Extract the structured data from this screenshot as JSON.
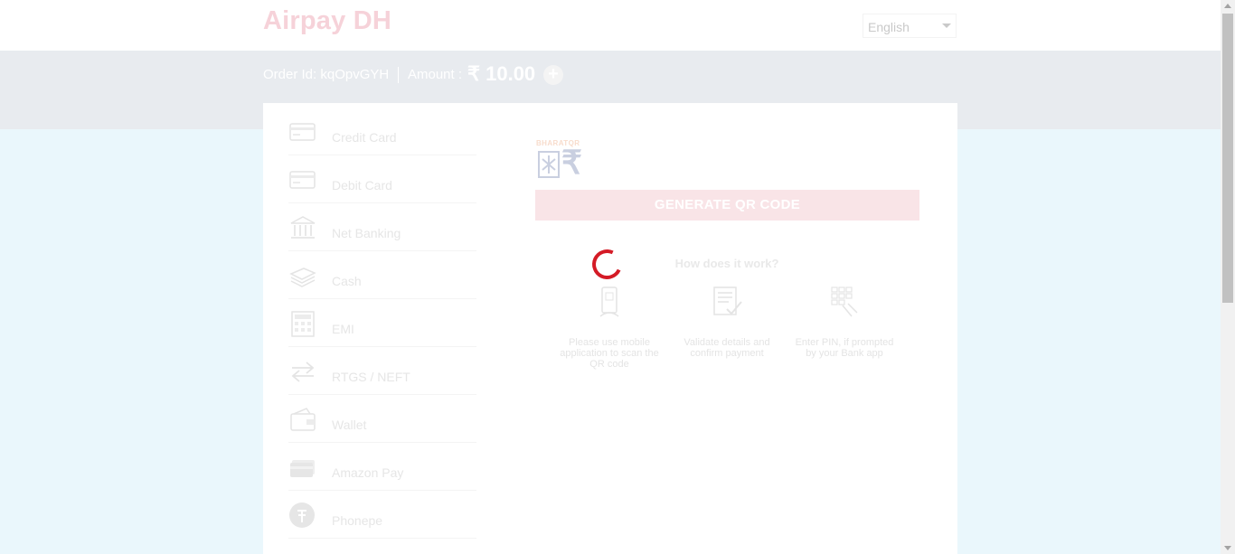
{
  "header": {
    "merchant_name": "Airpay DH",
    "language": "English",
    "language_icon": "chevron-down-icon"
  },
  "order": {
    "order_id_text": "Order Id: kqOpvGYH",
    "amount_label": "Amount :",
    "amount_value": "₹ 10.00",
    "expand_symbol": "+"
  },
  "methods": [
    {
      "label": "Credit Card",
      "icon": "credit-card-icon"
    },
    {
      "label": "Debit Card",
      "icon": "debit-card-icon"
    },
    {
      "label": "Net Banking",
      "icon": "bank-icon"
    },
    {
      "label": "Cash",
      "icon": "cash-icon"
    },
    {
      "label": "EMI",
      "icon": "calculator-icon"
    },
    {
      "label": "RTGS / NEFT",
      "icon": "transfer-icon"
    },
    {
      "label": "Wallet",
      "icon": "wallet-icon"
    },
    {
      "label": "Amazon Pay",
      "icon": "amazon-pay-icon"
    },
    {
      "label": "Phonepe",
      "icon": "phonepe-icon"
    }
  ],
  "qr": {
    "logo_text": "BHARATQR",
    "logo_symbol": "₹",
    "generate_label": "GENERATE QR CODE",
    "how_title": "How does it work?",
    "steps": [
      {
        "text": "Please use mobile application to scan the QR code",
        "icon": "mobile-scan-icon"
      },
      {
        "text": "Validate details and confirm payment",
        "icon": "document-check-icon"
      },
      {
        "text": "Enter PIN, if prompted by your Bank app",
        "icon": "keypad-icon"
      }
    ]
  },
  "colors": {
    "accent": "#d41b26",
    "header_band": "#e8ebef",
    "page_background": "#eaf7fc"
  }
}
